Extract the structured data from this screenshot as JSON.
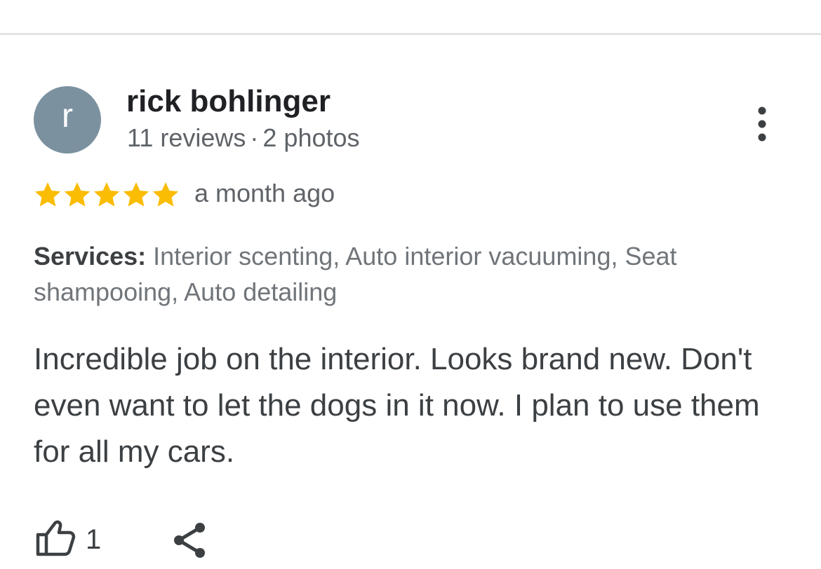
{
  "colors": {
    "avatar_background": "#7b919f",
    "star": "#fbbc04",
    "text_primary": "#202124",
    "text_secondary": "#5f6368",
    "icon": "#3c4043"
  },
  "reviewer": {
    "avatar_initial": "r",
    "name": "rick bohlinger",
    "reviews": "11 reviews",
    "separator": "·",
    "photos": "2 photos"
  },
  "more_options": {
    "icon": "more-vert-icon"
  },
  "rating": {
    "stars": 5,
    "max_stars": 5,
    "icon": "star-icon",
    "time": "a month ago"
  },
  "services": {
    "label": "Services:",
    "list": " Interior scenting, Auto interior vacuuming, Seat shampooing, Auto detailing"
  },
  "review": {
    "text": "Incredible job on the interior. Looks brand new. Don't even want to let the dogs in it now. I plan to use them for all my cars."
  },
  "actions": {
    "like_icon": "thumbs-up-icon",
    "like_count": "1",
    "share_icon": "share-icon"
  }
}
